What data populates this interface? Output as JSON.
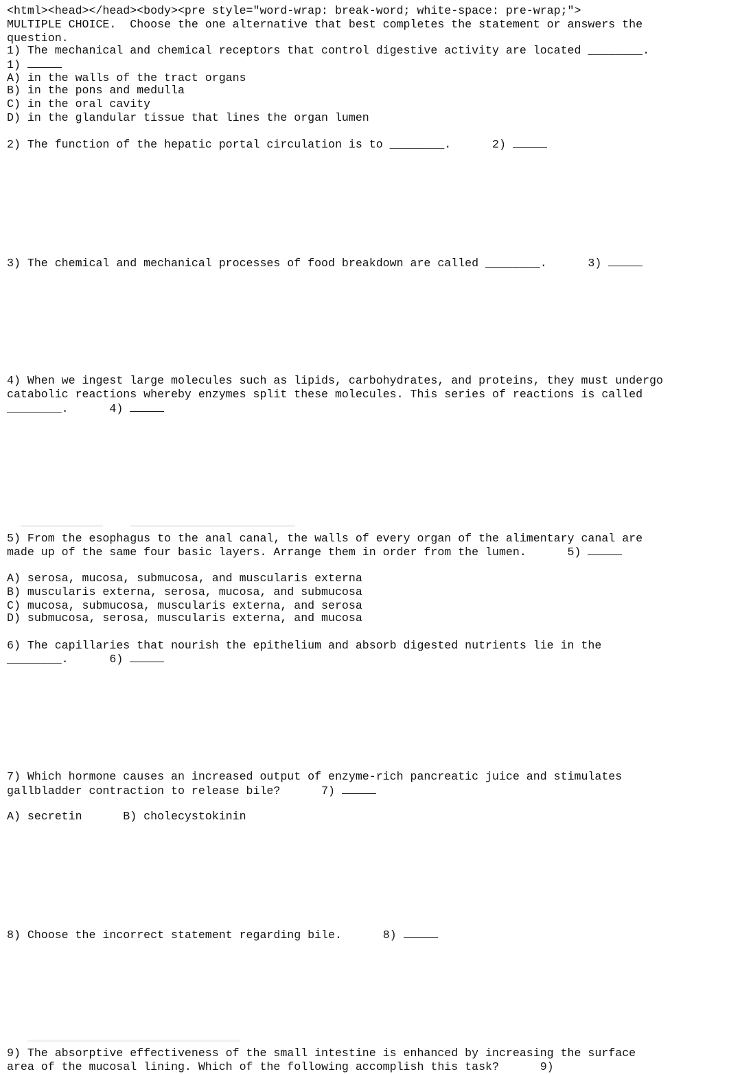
{
  "source_header": "<html><head></head><body><pre style=\"word-wrap: break-word; white-space: pre-wrap;\">",
  "instructions": {
    "line1": "MULTIPLE CHOICE.  Choose the one alternative that best completes the statement or answers the",
    "line2": "question."
  },
  "questions": [
    {
      "number": "1)",
      "lines": [
        "1) The mechanical and chemical receptors that control digestive activity are located ________."
      ],
      "answer_label": "1)",
      "options": [
        "A) in the walls of the tract organs",
        "B) in the pons and medulla",
        "C) in the oral cavity",
        "D) in the glandular tissue that lines the organ lumen"
      ]
    },
    {
      "number": "2)",
      "lines": [
        "2) The function of the hepatic portal circulation is to ________.      "
      ],
      "answer_label": "2)"
    },
    {
      "number": "3)",
      "lines": [
        "3) The chemical and mechanical processes of food breakdown are called ________.      "
      ],
      "answer_label": "3)"
    },
    {
      "number": "4)",
      "lines": [
        "4) When we ingest large molecules such as lipids, carbohydrates, and proteins, they must undergo",
        "catabolic reactions whereby enzymes split these molecules. This series of reactions is called",
        "________.      "
      ],
      "answer_label": "4)"
    },
    {
      "number": "5)",
      "lines": [
        "5) From the esophagus to the anal canal, the walls of every organ of the alimentary canal are",
        "made up of the same four basic layers. Arrange them in order from the lumen.      "
      ],
      "answer_label": "5)",
      "options": [
        "A) serosa, mucosa, submucosa, and muscularis externa",
        "B) muscularis externa, serosa, mucosa, and submucosa",
        "C) mucosa, submucosa, muscularis externa, and serosa",
        "D) submucosa, serosa, muscularis externa, and mucosa"
      ]
    },
    {
      "number": "6)",
      "lines": [
        "6) The capillaries that nourish the epithelium and absorb digested nutrients lie in the",
        "________.      "
      ],
      "answer_label": "6)"
    },
    {
      "number": "7)",
      "lines": [
        "7) Which hormone causes an increased output of enzyme-rich pancreatic juice and stimulates",
        "gallbladder contraction to release bile?      "
      ],
      "answer_label": "7)",
      "options_inline": "A) secretin      B) cholecystokinin"
    },
    {
      "number": "8)",
      "lines": [
        "8) Choose the incorrect statement regarding bile.      "
      ],
      "answer_label": "8)"
    },
    {
      "number": "9)",
      "lines": [
        "9) The absorptive effectiveness of the small intestine is enhanced by increasing the surface",
        "area of the mucosal lining. Which of the following accomplish this task?      "
      ],
      "answer_label": "9)"
    }
  ]
}
